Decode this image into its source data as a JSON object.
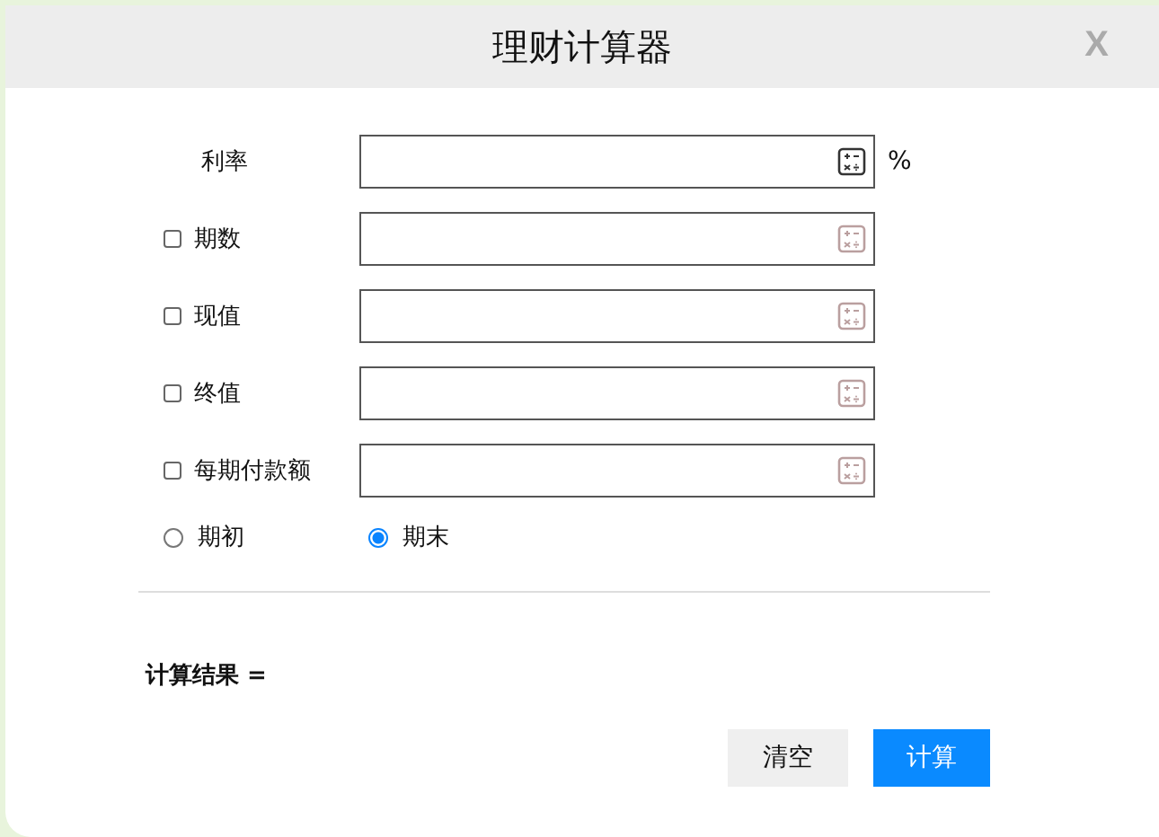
{
  "window": {
    "title": "理财计算器",
    "close": "X"
  },
  "fields": [
    {
      "kind": "plain",
      "label": "利率",
      "unit": "%"
    },
    {
      "kind": "checkbox",
      "label": "期数",
      "checked": false
    },
    {
      "kind": "checkbox",
      "label": "现值",
      "checked": false
    },
    {
      "kind": "checkbox",
      "label": "终值",
      "checked": false
    },
    {
      "kind": "checkbox",
      "label": "每期付款额",
      "checked": false
    }
  ],
  "timing": [
    {
      "label": "期初",
      "selected": false
    },
    {
      "label": "期末",
      "selected": true
    }
  ],
  "result": {
    "label": "计算结果 ="
  },
  "buttons": [
    {
      "kind": "secondary",
      "label": "清空"
    },
    {
      "kind": "primary",
      "label": "计算"
    }
  ]
}
